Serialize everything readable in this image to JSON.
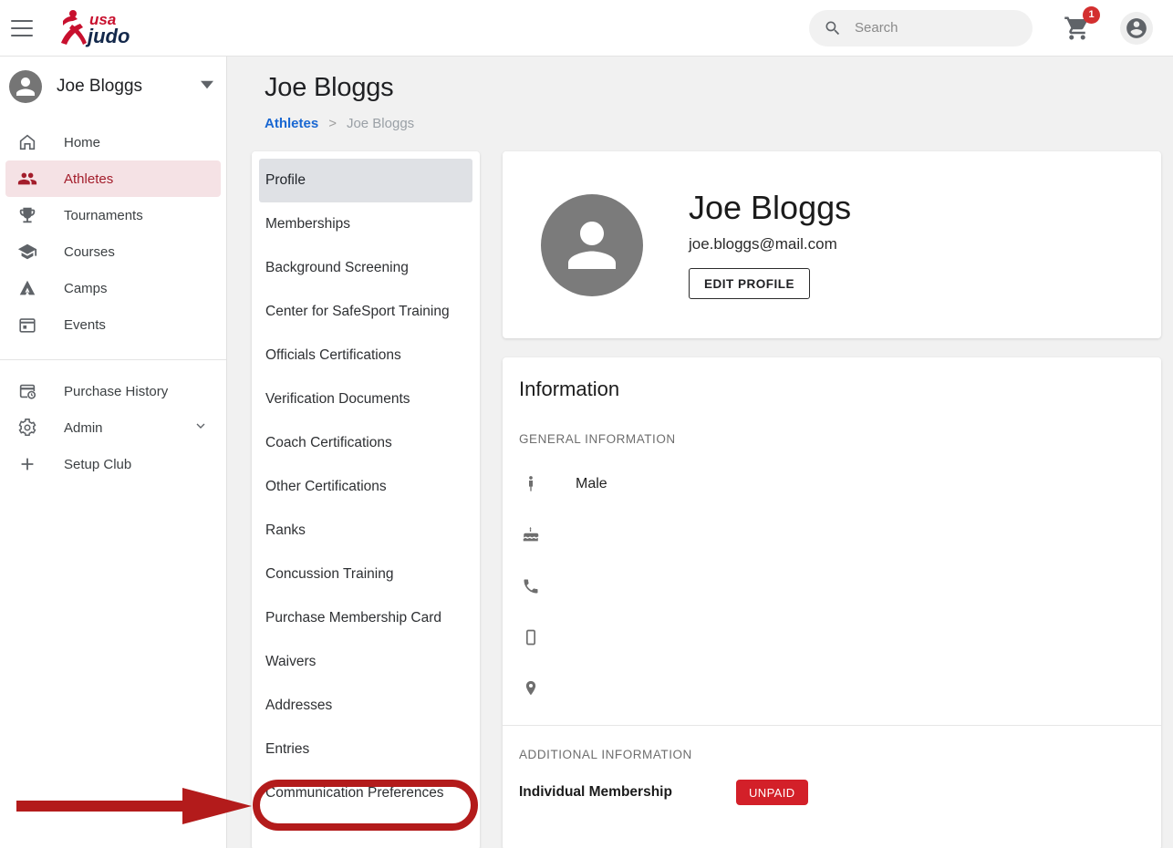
{
  "topbar": {
    "menu_icon": "hamburger-menu-icon",
    "logo_text_1": "usa",
    "logo_text_2": "judo",
    "search": {
      "placeholder": "Search",
      "value": "",
      "icon": "search-icon"
    },
    "cart": {
      "icon": "shopping-cart-icon",
      "badge_count": "1"
    },
    "account": {
      "icon": "account-circle-icon"
    }
  },
  "sidebar": {
    "user": {
      "name": "Joe Bloggs",
      "avatar_icon": "person-avatar-icon",
      "caret_icon": "caret-down-icon"
    },
    "items": [
      {
        "label": "Home",
        "icon": "home-icon",
        "active": false
      },
      {
        "label": "Athletes",
        "icon": "people-icon",
        "active": true
      },
      {
        "label": "Tournaments",
        "icon": "trophy-icon",
        "active": false
      },
      {
        "label": "Courses",
        "icon": "graduation-cap-icon",
        "active": false
      },
      {
        "label": "Camps",
        "icon": "tent-icon",
        "active": false
      },
      {
        "label": "Events",
        "icon": "calendar-icon",
        "active": false
      }
    ],
    "secondary_items": [
      {
        "label": "Purchase History",
        "icon": "receipt-history-icon",
        "active": false,
        "chevron": false
      },
      {
        "label": "Admin",
        "icon": "gear-icon",
        "active": false,
        "chevron": true
      },
      {
        "label": "Setup Club",
        "icon": "plus-icon",
        "active": false,
        "chevron": false
      }
    ]
  },
  "main": {
    "page_title": "Joe Bloggs",
    "breadcrumb": {
      "parent": "Athletes",
      "separator": ">",
      "current": "Joe Bloggs"
    },
    "tabs": [
      {
        "label": "Profile",
        "selected": true
      },
      {
        "label": "Memberships",
        "selected": false
      },
      {
        "label": "Background Screening",
        "selected": false
      },
      {
        "label": "Center for SafeSport Training",
        "selected": false
      },
      {
        "label": "Officials Certifications",
        "selected": false
      },
      {
        "label": "Verification Documents",
        "selected": false
      },
      {
        "label": "Coach Certifications",
        "selected": false
      },
      {
        "label": "Other Certifications",
        "selected": false
      },
      {
        "label": "Ranks",
        "selected": false
      },
      {
        "label": "Concussion Training",
        "selected": false
      },
      {
        "label": "Purchase Membership Card",
        "selected": false
      },
      {
        "label": "Waivers",
        "selected": false
      },
      {
        "label": "Addresses",
        "selected": false
      },
      {
        "label": "Entries",
        "selected": false
      },
      {
        "label": "Communication Preferences",
        "selected": false
      }
    ],
    "profile_card": {
      "avatar_icon": "person-avatar-icon",
      "name": "Joe Bloggs",
      "email": "joe.bloggs@mail.com",
      "edit_button": "EDIT PROFILE"
    },
    "information_card": {
      "title": "Information",
      "general_label": "GENERAL INFORMATION",
      "general_rows": [
        {
          "icon": "person-standing-icon",
          "value": "Male"
        },
        {
          "icon": "birthday-cake-icon",
          "value": ""
        },
        {
          "icon": "phone-icon",
          "value": ""
        },
        {
          "icon": "mobile-phone-icon",
          "value": ""
        },
        {
          "icon": "location-pin-icon",
          "value": ""
        }
      ],
      "additional_label": "ADDITIONAL INFORMATION",
      "additional_rows": [
        {
          "label": "Individual Membership",
          "badge": "UNPAID"
        }
      ]
    }
  },
  "annotations": {
    "highlight_target": "Communication Preferences",
    "arrow_color": "#b31b1b",
    "ring_color": "#b31b1b"
  }
}
